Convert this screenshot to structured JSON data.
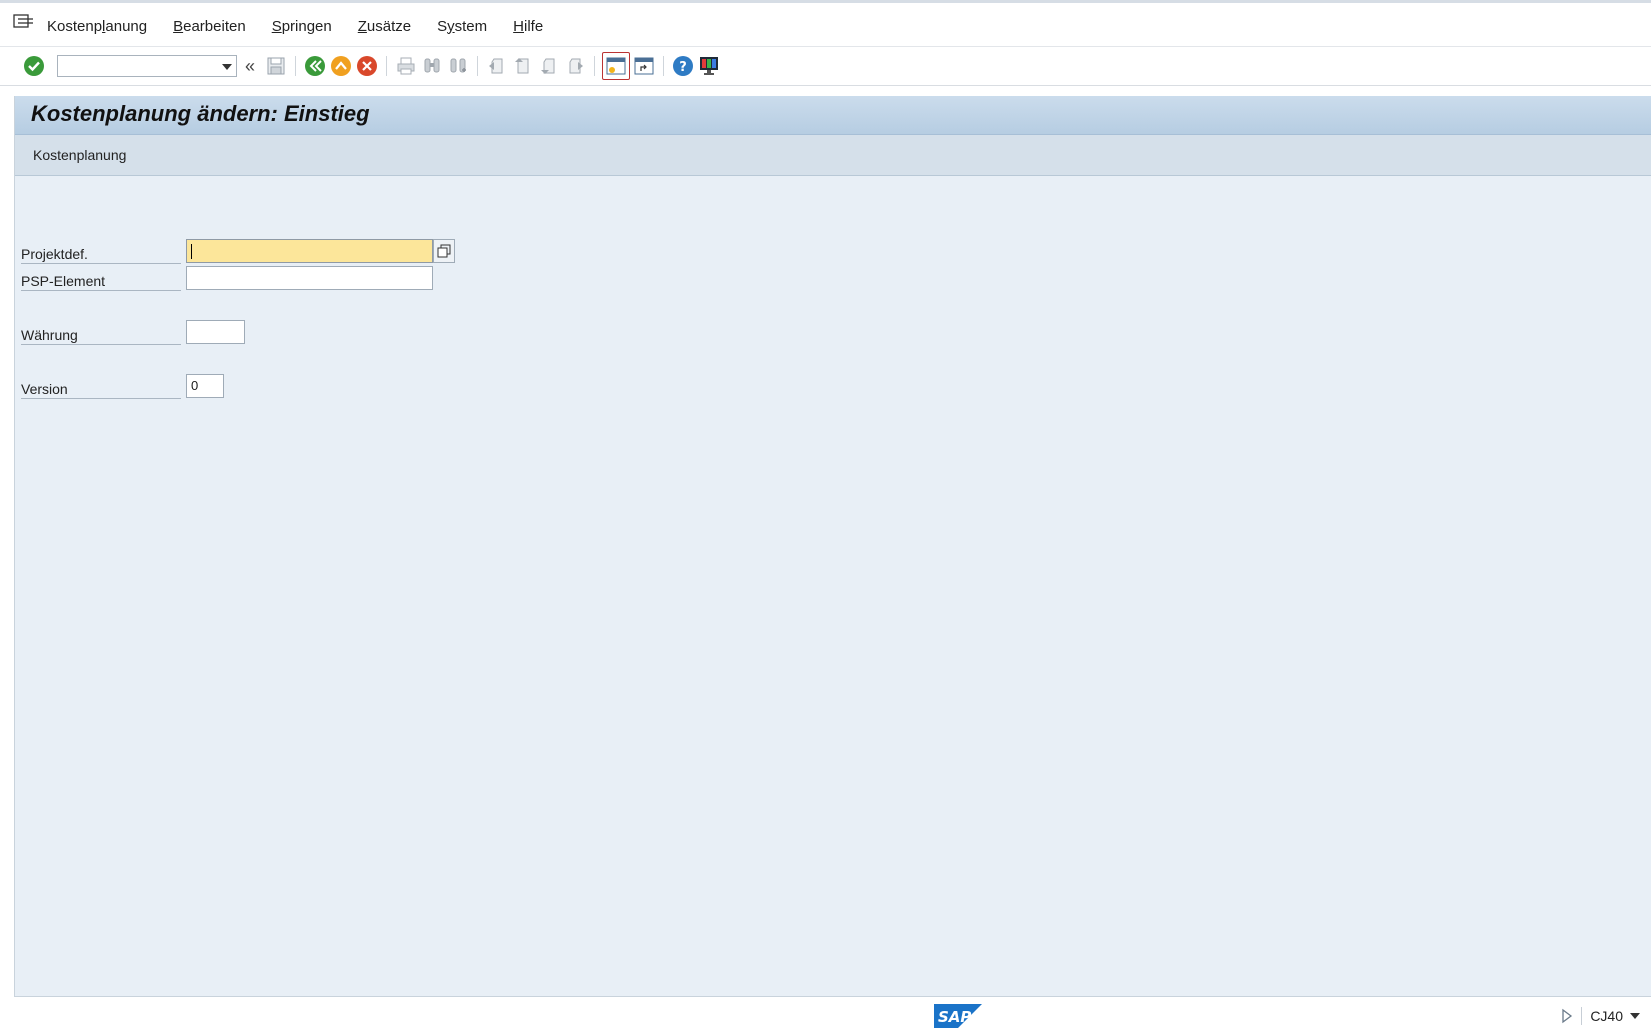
{
  "menubar": {
    "items": [
      {
        "pre": "Kostenp",
        "acc": "l",
        "post": "anung"
      },
      {
        "pre": "",
        "acc": "B",
        "post": "earbeiten"
      },
      {
        "pre": "",
        "acc": "S",
        "post": "pringen"
      },
      {
        "pre": "",
        "acc": "Z",
        "post": "usätze"
      },
      {
        "pre": "S",
        "acc": "y",
        "post": "stem"
      },
      {
        "pre": "",
        "acc": "H",
        "post": "ilfe"
      }
    ]
  },
  "toolbar": {
    "command_value": "",
    "icons": [
      "enter-icon",
      "command-dropdown",
      "collapse-icon",
      "save-icon",
      "back-icon",
      "exit-icon",
      "cancel-icon",
      "print-icon",
      "find-icon",
      "find-next-icon",
      "first-page-icon",
      "previous-page-icon",
      "next-page-icon",
      "last-page-icon",
      "create-session-icon",
      "create-shortcut-icon",
      "help-icon",
      "customize-layout-icon"
    ]
  },
  "screen": {
    "title": "Kostenplanung ändern: Einstieg",
    "subtitle": "Kostenplanung"
  },
  "form": {
    "projektdef_label": "Projektdef.",
    "projektdef_value": "",
    "psp_label": "PSP-Element",
    "psp_value": "",
    "waehrung_label": "Währung",
    "waehrung_value": "",
    "version_label": "Version",
    "version_value": "0"
  },
  "status": {
    "transaction": "CJ40",
    "logo_text": "SAP"
  },
  "colors": {
    "title_bar": "#b6cde2",
    "content_bg": "#e8eff6",
    "required_field": "#fce69a",
    "enter_green": "#3a9a3a",
    "exit_orange": "#f0a020",
    "cancel_red": "#d9482b",
    "sap_blue": "#1a73c8"
  }
}
